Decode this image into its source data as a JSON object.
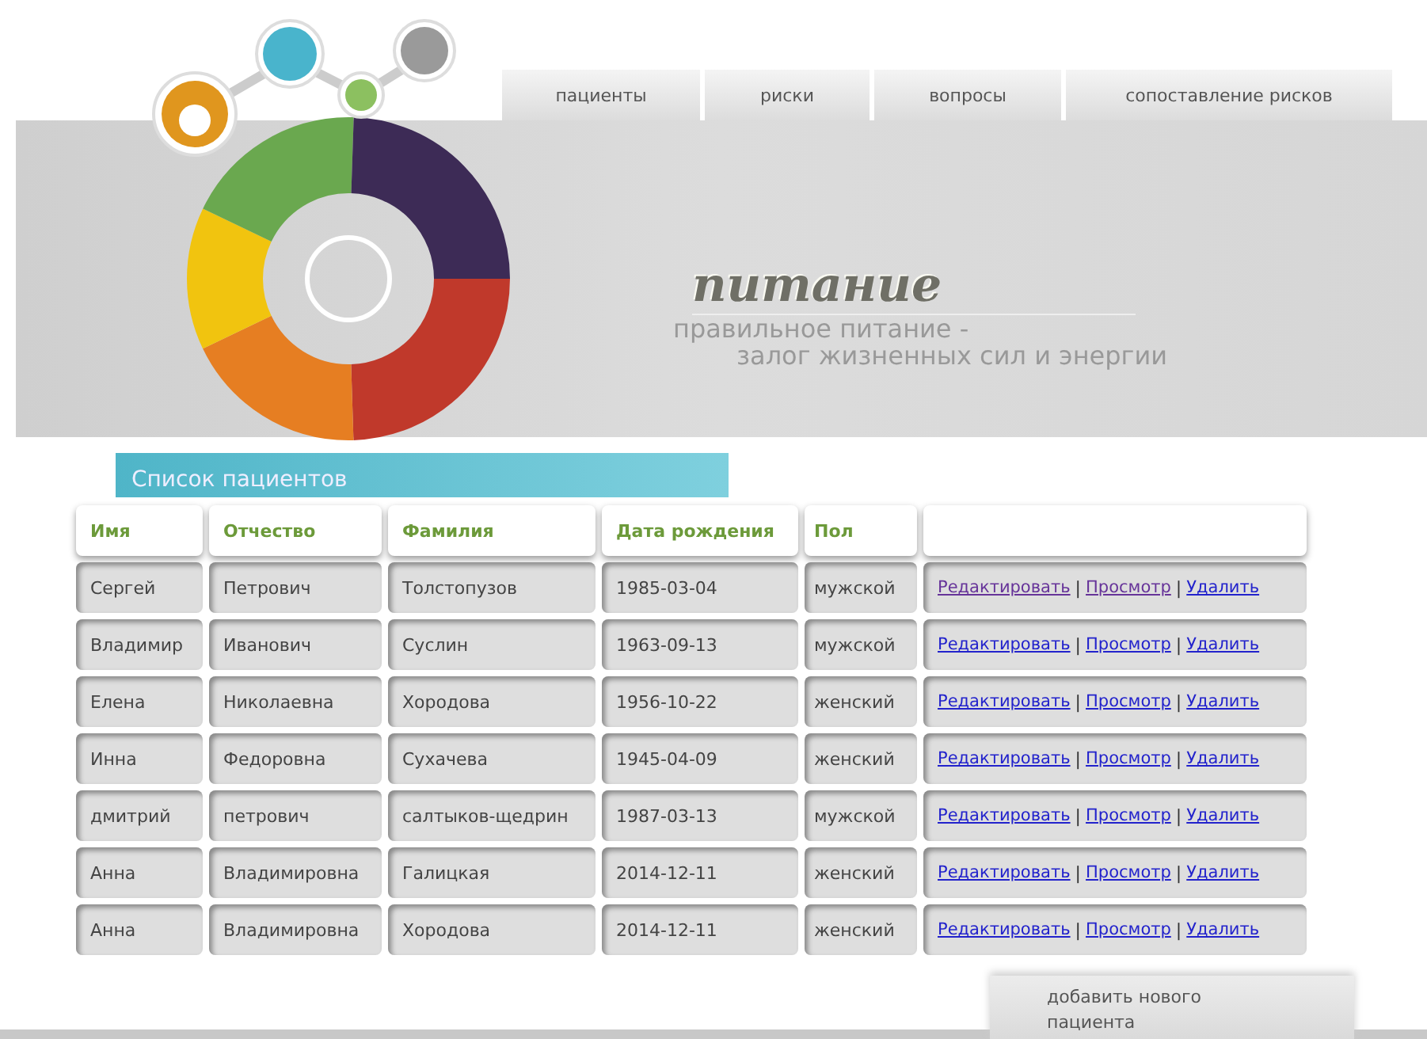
{
  "nav": {
    "tabs": [
      {
        "label": "пациенты",
        "selected": false
      },
      {
        "label": "риски",
        "selected": false
      },
      {
        "label": "вопросы",
        "selected": false
      },
      {
        "label": "сопоставление рисков",
        "selected": false
      }
    ]
  },
  "banner": {
    "title": "питание",
    "subtitle_line_1": "правильное питание -",
    "subtitle_line_2": "залог жизненных сил и энергии"
  },
  "section_title": "Список пациентов",
  "link_separator": "|",
  "table": {
    "columns": [
      "Имя",
      "Отчество",
      "Фамилия",
      "Дата рождения",
      "Пол"
    ],
    "rows": [
      {
        "cells": [
          "Сергей",
          "Петрович",
          "Толстопузов",
          "1985-03-04",
          "мужской"
        ],
        "links": [
          {
            "label": "Редактировать",
            "visited": true
          },
          {
            "label": "Просмотр",
            "visited": true
          },
          {
            "label": "Удалить",
            "visited": false
          }
        ]
      },
      {
        "cells": [
          "Владимир",
          "Иванович",
          "Суслин",
          "1963-09-13",
          "мужской"
        ],
        "links": [
          {
            "label": "Редактировать",
            "visited": false
          },
          {
            "label": "Просмотр",
            "visited": false
          },
          {
            "label": "Удалить",
            "visited": false
          }
        ]
      },
      {
        "cells": [
          "Елена",
          "Николаевна",
          "Хородова",
          "1956-10-22",
          "женский"
        ],
        "links": [
          {
            "label": "Редактировать",
            "visited": false
          },
          {
            "label": "Просмотр",
            "visited": false
          },
          {
            "label": "Удалить",
            "visited": false
          }
        ]
      },
      {
        "cells": [
          "Инна",
          "Федоровна",
          "Сухачева",
          "1945-04-09",
          "женский"
        ],
        "links": [
          {
            "label": "Редактировать",
            "visited": false
          },
          {
            "label": "Просмотр",
            "visited": false
          },
          {
            "label": "Удалить",
            "visited": false
          }
        ]
      },
      {
        "cells": [
          "дмитрий",
          "петрович",
          "салтыков-щедрин",
          "1987-03-13",
          "мужской"
        ],
        "links": [
          {
            "label": "Редактировать",
            "visited": false
          },
          {
            "label": "Просмотр",
            "visited": false
          },
          {
            "label": "Удалить",
            "visited": false
          }
        ]
      },
      {
        "cells": [
          "Анна",
          "Владимировна",
          "Галицкая",
          "2014-12-11",
          "женский"
        ],
        "links": [
          {
            "label": "Редактировать",
            "visited": false
          },
          {
            "label": "Просмотр",
            "visited": false
          },
          {
            "label": "Удалить",
            "visited": false
          }
        ]
      },
      {
        "cells": [
          "Анна",
          "Владимировна",
          "Хородова",
          "2014-12-11",
          "женский"
        ],
        "links": [
          {
            "label": "Редактировать",
            "visited": false
          },
          {
            "label": "Просмотр",
            "visited": false
          },
          {
            "label": "Удалить",
            "visited": false
          }
        ]
      }
    ]
  },
  "add_button": {
    "line_1": "добавить нового",
    "line_2": "пациента"
  }
}
